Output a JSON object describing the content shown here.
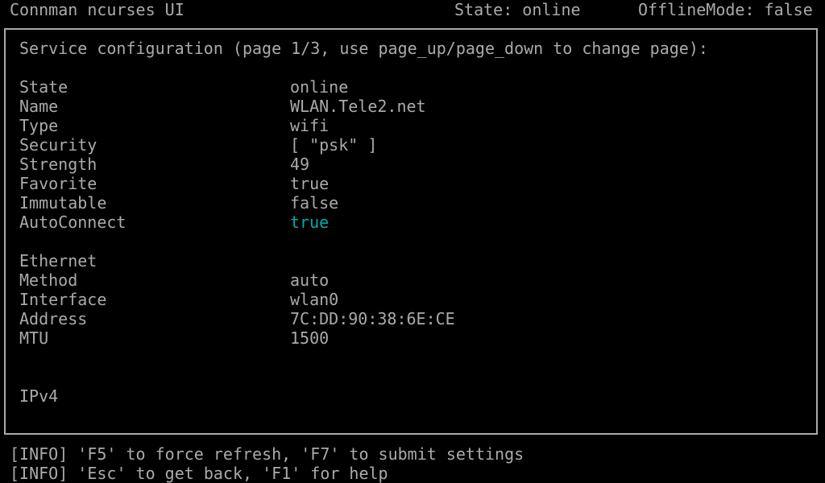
{
  "header": {
    "title": "Connman ncurses UI",
    "state": "State: online",
    "offline_mode": "OfflineMode: false"
  },
  "panel": {
    "heading": "Service configuration (page 1/3, use page_up/page_down to change page):",
    "general": [
      {
        "label": "State",
        "value": "online"
      },
      {
        "label": "Name",
        "value": "WLAN.Tele2.net"
      },
      {
        "label": "Type",
        "value": "wifi"
      },
      {
        "label": "Security",
        "value": "[ \"psk\" ]"
      },
      {
        "label": "Strength",
        "value": "49"
      },
      {
        "label": "Favorite",
        "value": "true"
      },
      {
        "label": "Immutable",
        "value": "false"
      },
      {
        "label": "AutoConnect",
        "value": "true",
        "editable": true
      }
    ],
    "ethernet_heading": "Ethernet",
    "ethernet": [
      {
        "label": "Method",
        "value": "auto"
      },
      {
        "label": "Interface",
        "value": "wlan0"
      },
      {
        "label": "Address",
        "value": "7C:DD:90:38:6E:CE"
      },
      {
        "label": "MTU",
        "value": "1500"
      }
    ],
    "ipv4_heading": "IPv4"
  },
  "footer": [
    "[INFO] 'F5' to force refresh, 'F7' to submit settings",
    "[INFO] 'Esc' to get back, 'F1' for help"
  ],
  "colors": {
    "text": "#aaaaaa",
    "editable": "#00aaaa",
    "background": "#000000"
  }
}
